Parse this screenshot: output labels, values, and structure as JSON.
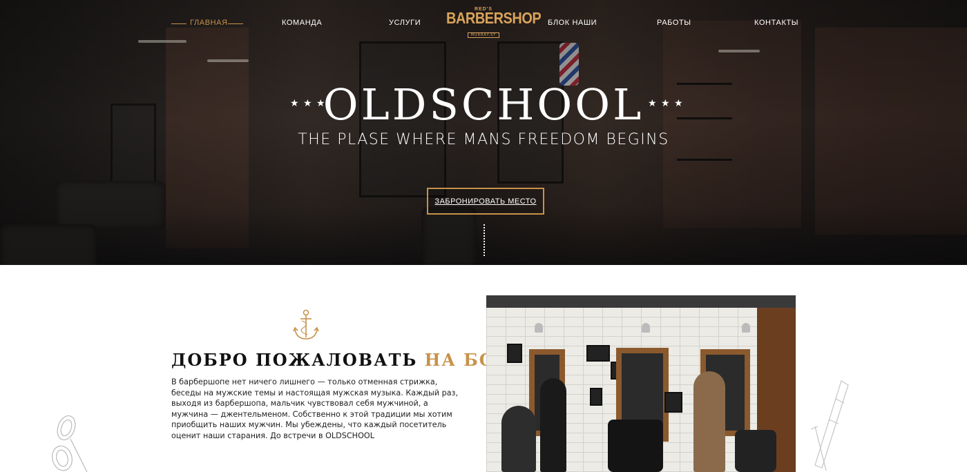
{
  "nav": {
    "items": [
      {
        "label": "ГЛАВНАЯ",
        "active": true
      },
      {
        "label": "КОМАНДА",
        "active": false
      },
      {
        "label": "УСЛУГИ",
        "active": false
      },
      {
        "label": "БЛОК НАШИ",
        "active": false
      },
      {
        "label": "РАБОТЫ",
        "active": false
      },
      {
        "label": "КОНТАКТЫ",
        "active": false
      }
    ]
  },
  "logo": {
    "top": "RED'S",
    "main": "BARBERSHOP",
    "sub": "MURRAY.ST"
  },
  "hero": {
    "title": "OLDSCHOOL",
    "subtitle": "THE PLASE WHERE MANS FREEDOM BEGINS",
    "stars_left": "★ ★ ★",
    "stars_right": "★ ★ ★",
    "cta_label": "ЗАБРОНИРОВАТЬ МЕСТО"
  },
  "welcome": {
    "heading_main": "ДОБРО ПОЖАЛОВАТЬ",
    "heading_accent": "НА БОРТ",
    "body": "В барбершопе нет ничего лишнего — только отменная стрижка, беседы на мужские темы и настоящая мужская музыка. Каждый раз, выходя из барбершопа, мальчик чувствовал себя мужчиной, а мужчина — джентельменом. Собственно к этой традиции мы хотим приобщить наших мужчин. Мы убеждены, что каждый посетитель оценит наши старания. До встречи в OLDSCHOOL"
  },
  "colors": {
    "accent": "#c8924a",
    "text_dark": "#111111",
    "hero_text": "#ffffff"
  },
  "icons": [
    "anchor-icon",
    "scissors-icon",
    "straight-razor-icon",
    "star-icon"
  ]
}
